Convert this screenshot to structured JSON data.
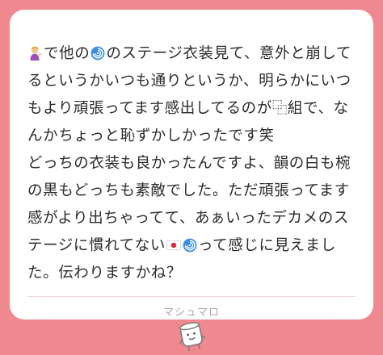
{
  "message": {
    "lines": [
      {
        "pre_icon": "person-tipping-hand-icon",
        "text1": "で他の",
        "mid_icon": "cyclone-icon",
        "text2": "のステージ衣装見て、意外と崩して"
      },
      {
        "text": "るというかいつも通りというか、明らかにいつ"
      },
      {
        "text": "もより頑張ってます感出してるのが⿻組で、な"
      },
      {
        "text": "んかちょっと恥ずかしかったです笑"
      },
      {
        "text": "どっちの衣装も良かったんですよ、韻の白も椀"
      },
      {
        "text": "の黒もどっちも素敵でした。ただ頑張ってます"
      },
      {
        "text": "感がより出ちゃってて、あぁいったデカメのス"
      },
      {
        "text1": "テージに慣れてない",
        "icon1": "japan-flag-icon",
        "icon2": "cyclone-icon",
        "text2": "って感じに見えまし"
      },
      {
        "text": "た。伝わりますかね？"
      }
    ]
  },
  "footer": {
    "brand": "マシュマロ"
  },
  "colors": {
    "background": "#f0888f",
    "card": "#ffffff",
    "text": "#2b2b2b",
    "brand_text": "#a8a8a8"
  }
}
